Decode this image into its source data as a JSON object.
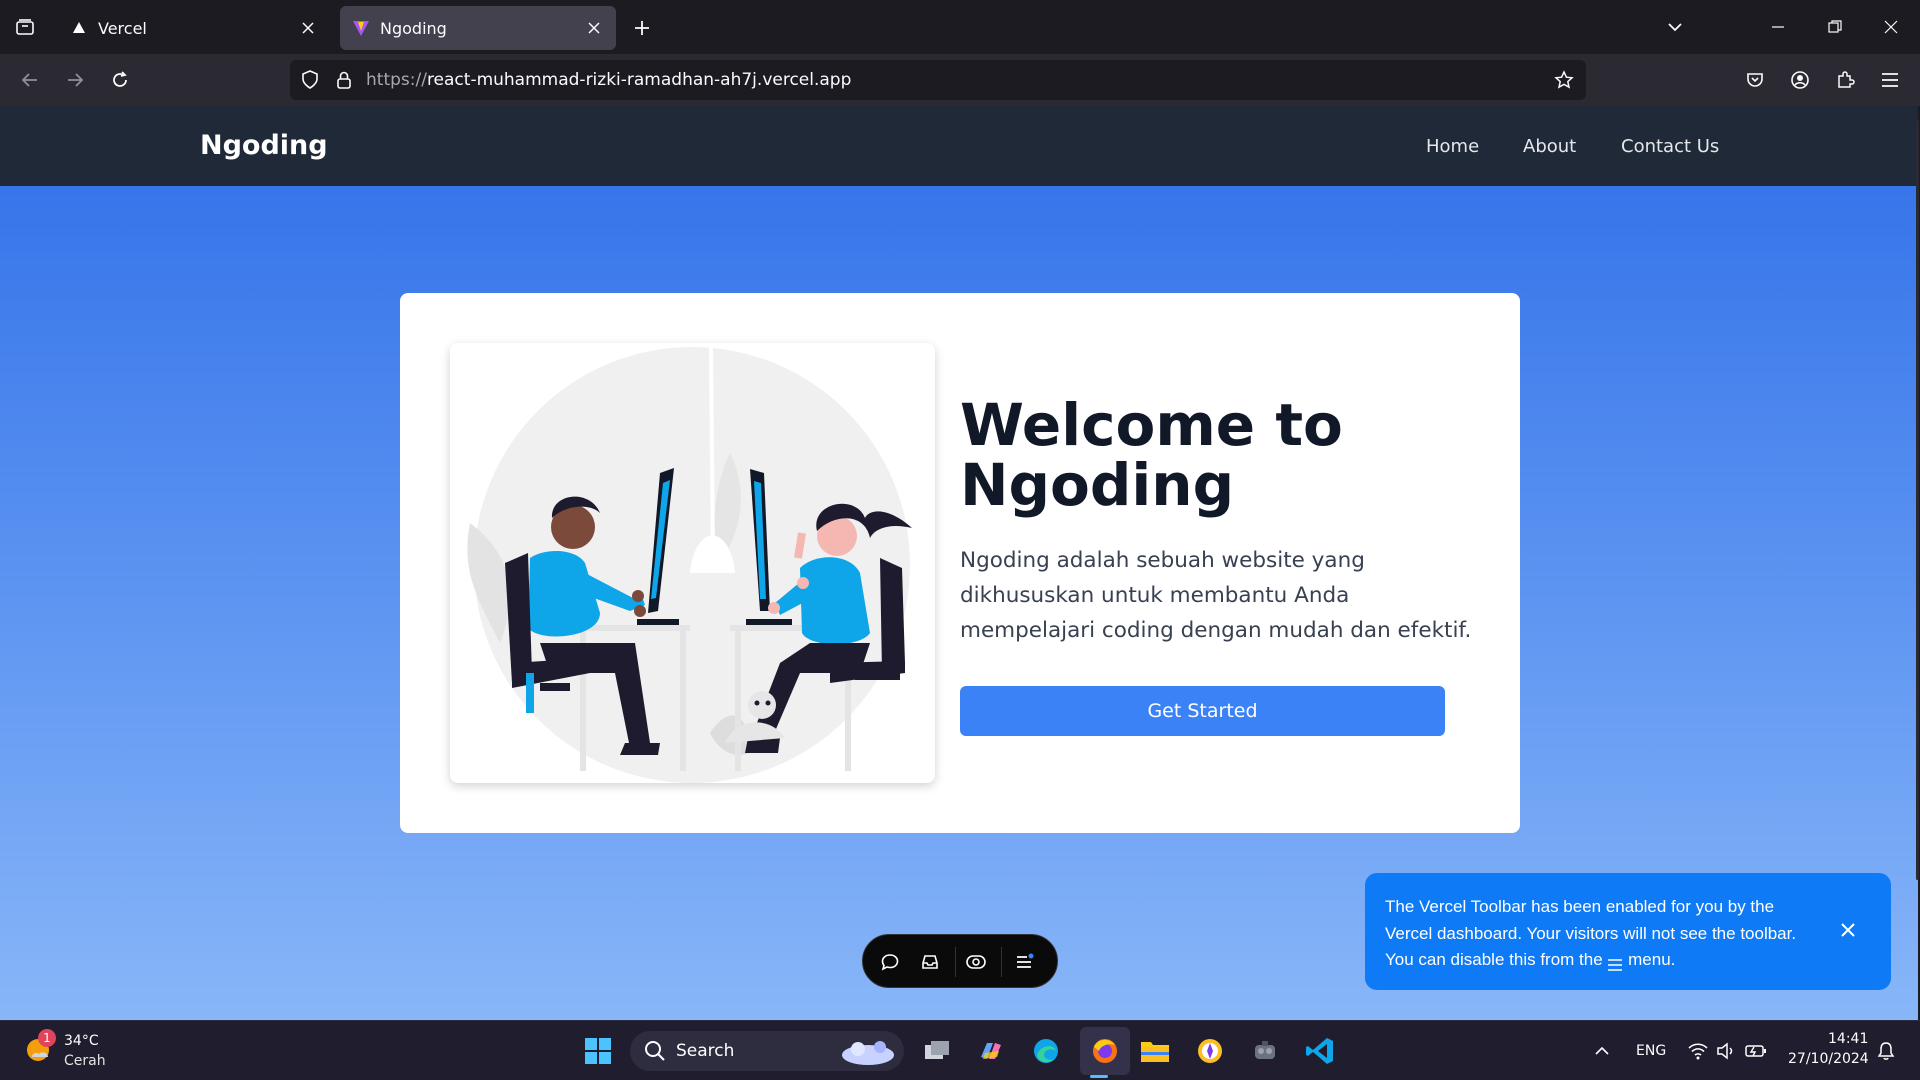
{
  "browser": {
    "tabs": [
      {
        "title": "Vercel",
        "active": false
      },
      {
        "title": "Ngoding",
        "active": true
      }
    ],
    "url": {
      "scheme": "https://",
      "host": "react-muhammad-rizki-ramadhan-ah7j.vercel.app"
    }
  },
  "site": {
    "brand": "Ngoding",
    "menu": [
      "Home",
      "About",
      "Contact Us"
    ],
    "hero": {
      "title": "Welcome to Ngoding",
      "description": "Ngoding adalah sebuah website yang dikhususkan untuk membantu Anda mempelajari coding dengan mudah dan efektif.",
      "cta": "Get Started"
    }
  },
  "vercel_toast": {
    "text_before": "The Vercel Toolbar has been enabled for you by the Vercel dashboard. Your visitors will not see the toolbar. You can disable this from the ",
    "text_after": " menu."
  },
  "taskbar": {
    "weather": {
      "temp": "34°C",
      "condition": "Cerah",
      "badge": "1"
    },
    "search_label": "Search",
    "language": "ENG",
    "time": "14:41",
    "date": "27/10/2024"
  },
  "colors": {
    "nav_bg": "#1f2937",
    "accent": "#3b82f6",
    "toast": "#0e7af5",
    "illustration_blue": "#0ea5e9"
  }
}
